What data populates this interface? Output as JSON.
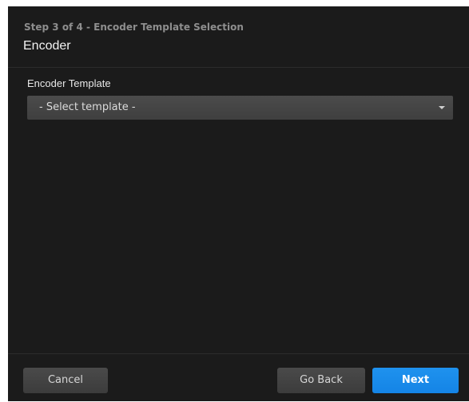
{
  "header": {
    "step": "Step 3 of 4 - Encoder Template Selection",
    "title": "Encoder"
  },
  "form": {
    "encoder_template_label": "Encoder Template",
    "encoder_template_value": "- Select template -"
  },
  "footer": {
    "cancel_label": "Cancel",
    "back_label": "Go Back",
    "next_label": "Next"
  },
  "colors": {
    "dialog_background": "#1b1b1b",
    "primary_button": "#1a8cec",
    "secondary_button": "#434343"
  },
  "icons": {
    "select_caret": "caret-down-icon"
  }
}
